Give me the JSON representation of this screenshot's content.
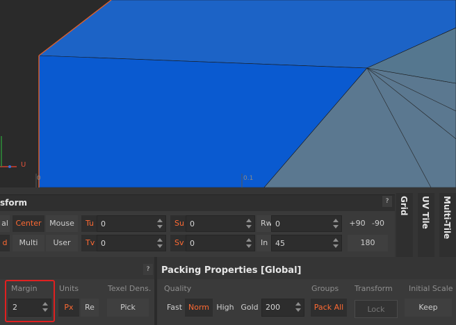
{
  "viewport": {
    "axis_u": "U",
    "tick_0": "0",
    "tick_01": "0.1"
  },
  "transform": {
    "title": "sform",
    "help": "?",
    "row1": {
      "al": "al",
      "center": "Center",
      "mouse": "Mouse",
      "tu_label": "Tu",
      "tu_value": "0",
      "su_label": "Su",
      "su_value": "0",
      "rw_label": "Rw",
      "rw_value": "0",
      "plus90": "+90",
      "minus90": "-90"
    },
    "row2": {
      "d": "d",
      "multi": "Multi",
      "user": "User",
      "tv_label": "Tv",
      "tv_value": "0",
      "sv_label": "Sv",
      "sv_value": "0",
      "in_label": "In",
      "in_value": "45",
      "r180": "180"
    },
    "tabs": [
      "Grid",
      "UV Tile",
      "Multi-Tile"
    ]
  },
  "left_bottom": {
    "help": "?",
    "margin_label": "Margin",
    "margin_value": "2",
    "units_label": "Units",
    "px": "Px",
    "re": "Re",
    "texel_label": "Texel Dens.",
    "pick": "Pick"
  },
  "packing": {
    "title": "Packing Properties [Global]",
    "quality_label": "Quality",
    "fast": "Fast",
    "norm": "Norm",
    "high": "High",
    "gold": "Gold",
    "gold_value": "200",
    "groups_label": "Groups",
    "pack_all": "Pack All",
    "transform_label": "Transform",
    "lock": "Lock",
    "initial_scale_label": "Initial Scale",
    "keep": "Keep"
  },
  "colors": {
    "accent": "#ff6a33",
    "uv_blue": "#0a5ad0",
    "uv_slate": "#5a7891",
    "highlight": "#e02020"
  }
}
